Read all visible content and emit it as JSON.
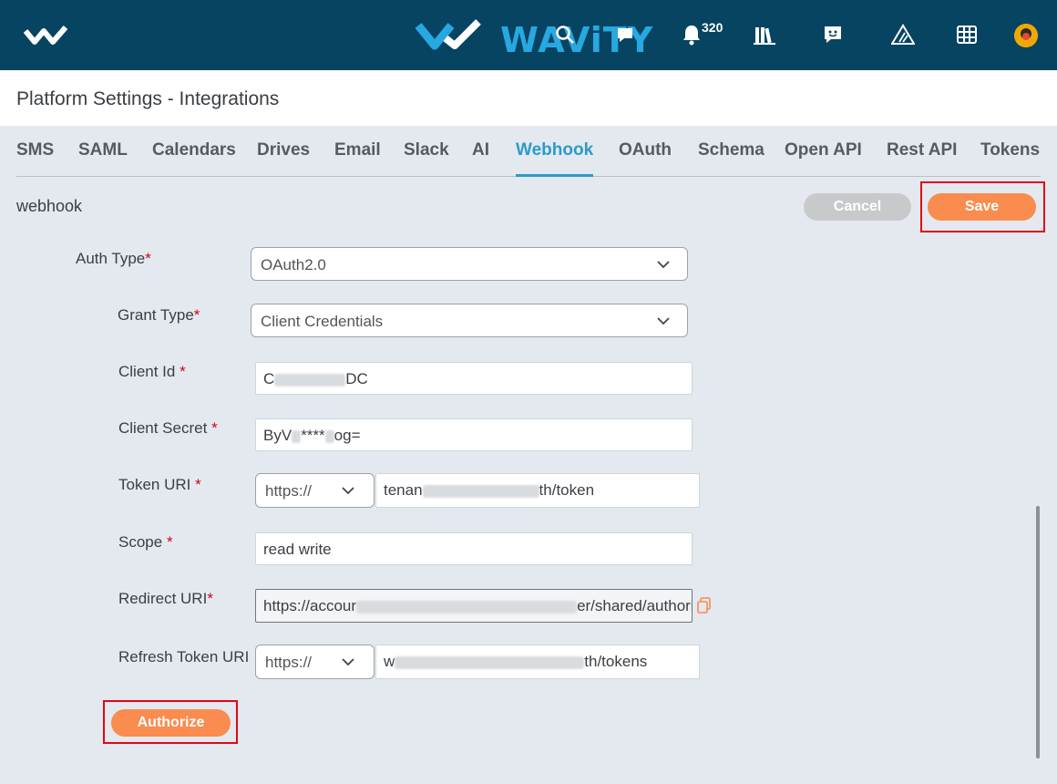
{
  "header": {
    "brand": "WAViTY",
    "notification_count": "320",
    "icons": [
      "small-logo-icon",
      "search-icon",
      "chat-bubble-icon",
      "bell-icon",
      "library-icon",
      "feedback-icon",
      "map-icon",
      "grid-icon",
      "avatar"
    ]
  },
  "page": {
    "title": "Platform Settings - Integrations"
  },
  "tabs": [
    {
      "label": "SMS"
    },
    {
      "label": "SAML"
    },
    {
      "label": "Calendars"
    },
    {
      "label": "Drives"
    },
    {
      "label": "Email"
    },
    {
      "label": "Slack"
    },
    {
      "label": "AI"
    },
    {
      "label": "Webhook",
      "active": true
    },
    {
      "label": "OAuth"
    },
    {
      "label": "Schema"
    },
    {
      "label": "Open API"
    },
    {
      "label": "Rest API"
    },
    {
      "label": "Tokens"
    }
  ],
  "section": {
    "label": "webhook"
  },
  "actions": {
    "cancel": "Cancel",
    "save": "Save",
    "authorize": "Authorize"
  },
  "form": {
    "auth_type": {
      "label": "Auth Type",
      "value": "OAuth2.0"
    },
    "grant_type": {
      "label": "Grant Type",
      "value": "Client Credentials"
    },
    "client_id": {
      "label": "Client Id",
      "value_start": "C",
      "value_end": "DC"
    },
    "client_secret": {
      "label": "Client Secret",
      "value_start": "ByV",
      "value_mid": "****",
      "value_end": "og="
    },
    "token_uri": {
      "label": "Token URI",
      "protocol": "https://",
      "value_start": "tenan",
      "value_end": "th/token"
    },
    "scope": {
      "label": "Scope",
      "value": "read write"
    },
    "redirect_uri": {
      "label": "Redirect URI",
      "value_start": "https://accour",
      "value_end": "er/shared/authori:"
    },
    "refresh_token_uri": {
      "label": "Refresh Token URI",
      "protocol": "https://",
      "value_start": "w",
      "value_end": "th/tokens"
    },
    "required_mark": "*"
  },
  "colors": {
    "header_bg": "#074461",
    "brand": "#27a8e0",
    "accent": "#f98c4e",
    "tab_active": "#2c9bc9"
  }
}
